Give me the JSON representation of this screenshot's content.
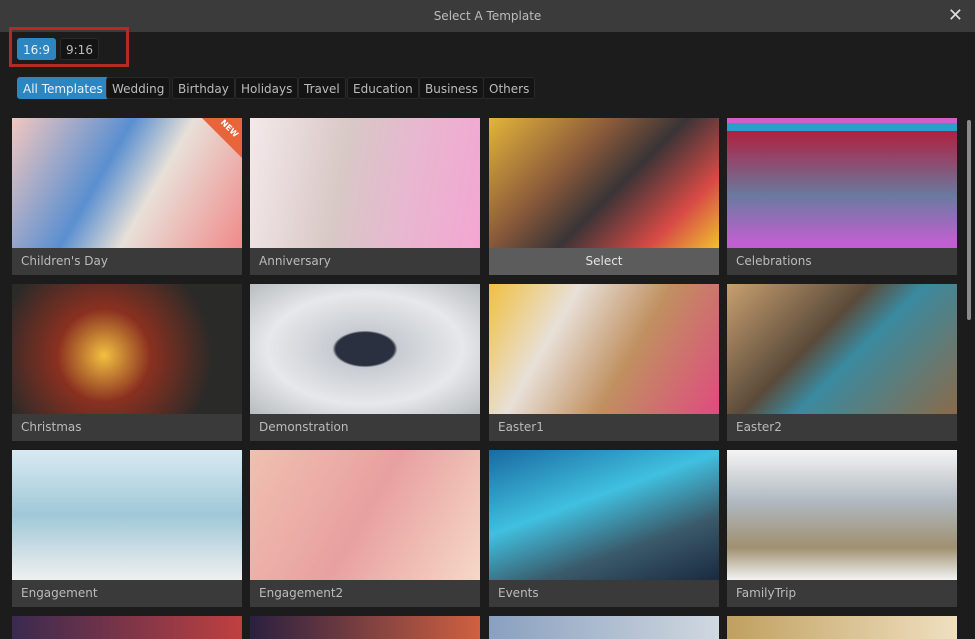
{
  "window": {
    "title": "Select A Template",
    "close_icon": "close-icon"
  },
  "ratios": [
    {
      "label": "16:9",
      "active": true
    },
    {
      "label": "9:16",
      "active": false
    }
  ],
  "categories": [
    {
      "label": "All Templates",
      "active": true
    },
    {
      "label": "Wedding"
    },
    {
      "label": "Birthday"
    },
    {
      "label": "Holidays"
    },
    {
      "label": "Travel"
    },
    {
      "label": "Education"
    },
    {
      "label": "Business"
    },
    {
      "label": "Others"
    }
  ],
  "templates": [
    {
      "name": "Children's Day",
      "badge": "NEW"
    },
    {
      "name": "Anniversary"
    },
    {
      "name": "Select",
      "hovered": true
    },
    {
      "name": "Celebrations"
    },
    {
      "name": "Christmas"
    },
    {
      "name": "Demonstration"
    },
    {
      "name": "Easter1"
    },
    {
      "name": "Easter2"
    },
    {
      "name": "Engagement"
    },
    {
      "name": "Engagement2"
    },
    {
      "name": "Events"
    },
    {
      "name": "FamilyTrip"
    }
  ],
  "colors": {
    "accent": "#2e86c1",
    "highlight_box": "#b52a22"
  }
}
